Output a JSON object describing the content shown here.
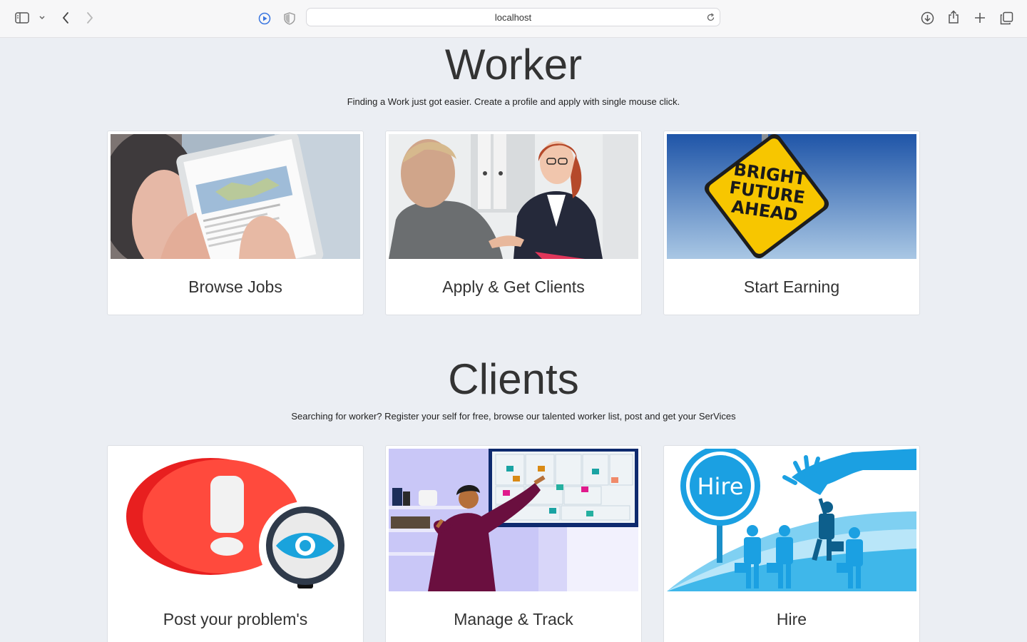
{
  "browser": {
    "address": "localhost",
    "icons": [
      "sidebar-icon",
      "chevron-down-icon",
      "back-icon",
      "forward-icon",
      "play-icon",
      "shield-icon",
      "reload-icon",
      "download-icon",
      "share-icon",
      "plus-icon",
      "tabs-icon"
    ]
  },
  "worker": {
    "title": "Worker",
    "subtitle": "Finding a Work just got easier. Create a profile and apply with single mouse click.",
    "cards": [
      {
        "label": "Browse Jobs"
      },
      {
        "label": "Apply & Get Clients"
      },
      {
        "label": "Start Earning",
        "sign_text": [
          "BRIGHT",
          "FUTURE",
          "AHEAD"
        ]
      }
    ]
  },
  "clients": {
    "title": "Clients",
    "subtitle": "Searching for worker? Register your self for free, browse our talented worker list, post and get your SerVices",
    "cards": [
      {
        "label": "Post your problem's"
      },
      {
        "label": "Manage & Track"
      },
      {
        "label": "Hire",
        "badge_text": "Hire"
      }
    ]
  },
  "colors": {
    "page_bg": "#ebeef3",
    "card_bg": "#ffffff",
    "alert_red": "#ff4a3d",
    "sign_yellow": "#f7c600",
    "hire_blue": "#1ba0e2"
  }
}
